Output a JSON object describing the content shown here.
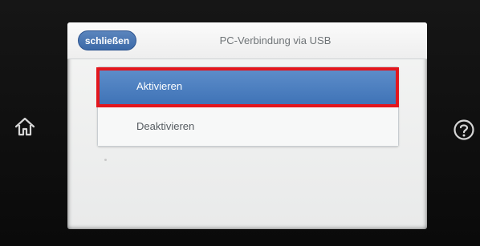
{
  "header": {
    "close_label": "schließen",
    "title": "PC-Verbindung via USB"
  },
  "menu": {
    "items": [
      {
        "label": "Aktivieren",
        "selected": true
      },
      {
        "label": "Deaktivieren",
        "selected": false
      }
    ]
  },
  "side_buttons": {
    "left_icon": "home-icon",
    "right_icon": "help-icon"
  },
  "colors": {
    "accent_blue": "#3e72b6",
    "highlight_red": "#e3161d",
    "screen_bg": "#f0f1f1",
    "device_bezel": "#0d0d0d"
  }
}
